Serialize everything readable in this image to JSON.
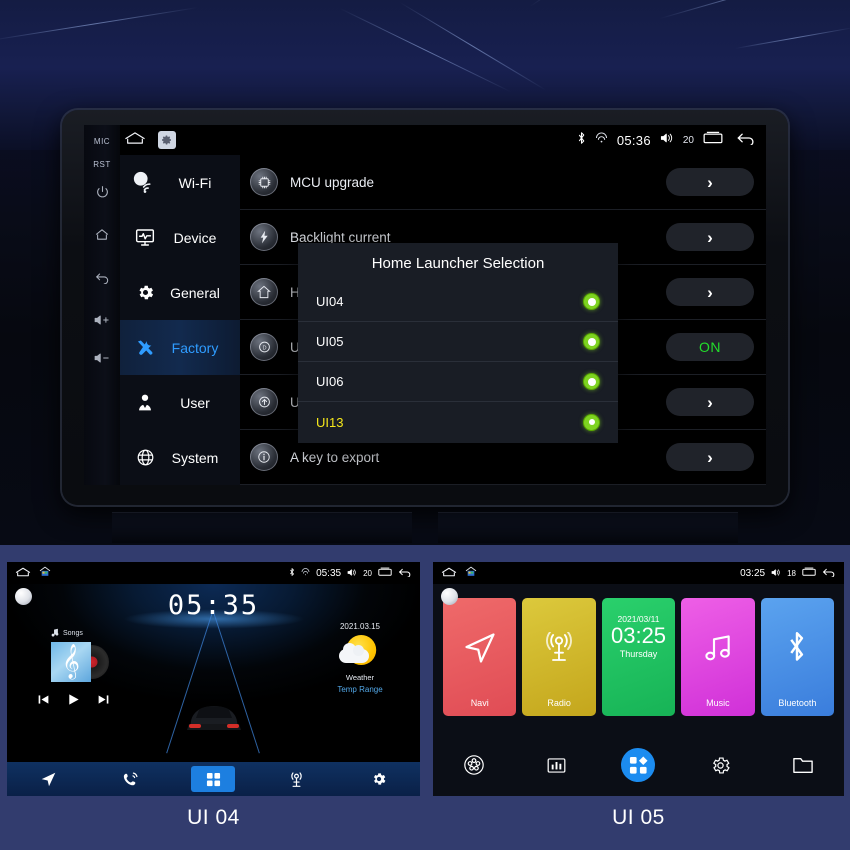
{
  "main_unit": {
    "hard_keys": [
      {
        "name": "MIC",
        "type": "text"
      },
      {
        "name": "RST",
        "type": "text"
      },
      {
        "name": "power",
        "type": "icon"
      },
      {
        "name": "home",
        "type": "icon"
      },
      {
        "name": "back",
        "type": "icon"
      },
      {
        "name": "volume-up",
        "type": "icon"
      },
      {
        "name": "volume-down",
        "type": "icon"
      }
    ],
    "status_bar": {
      "home_icon": "home-icon",
      "settings_icon": "gear-icon",
      "bluetooth_icon": "bluetooth-icon",
      "wifi_icon": "wifi-icon",
      "time": "05:36",
      "volume_icon": "volume-icon",
      "volume_level": "20",
      "recents_icon": "recents-icon",
      "back_icon": "back-icon"
    },
    "nav_items": [
      {
        "label": "Wi-Fi",
        "icon": "wifi-icon",
        "active": false
      },
      {
        "label": "Device",
        "icon": "device-icon",
        "active": false
      },
      {
        "label": "General",
        "icon": "gear-icon",
        "active": false
      },
      {
        "label": "Factory",
        "icon": "tools-icon",
        "active": true
      },
      {
        "label": "User",
        "icon": "user-icon",
        "active": false
      },
      {
        "label": "System",
        "icon": "globe-icon",
        "active": false
      }
    ],
    "settings_rows": [
      {
        "icon": "mcu-chip-icon",
        "label": "MCU upgrade",
        "action": "›",
        "action_type": "chevron"
      },
      {
        "icon": "backlight-icon",
        "label": "Backlight current",
        "action": "›",
        "action_type": "chevron"
      },
      {
        "icon": "launcher-icon",
        "label": "Home Launcher Selection  Current selection:UI13",
        "action": "›",
        "action_type": "chevron"
      },
      {
        "icon": "usb-error-icon",
        "label": "USB Error detection",
        "action": "ON",
        "action_type": "toggle"
      },
      {
        "icon": "usb-protocol-icon",
        "label": "USB protocol selection  Current Protocol 2.0",
        "action": "›",
        "action_type": "chevron"
      },
      {
        "icon": "info-icon",
        "label": "A key to export",
        "action": "›",
        "action_type": "chevron"
      }
    ],
    "dialog": {
      "title": "Home Launcher Selection",
      "options": [
        {
          "label": "UI04",
          "selected": false
        },
        {
          "label": "UI05",
          "selected": false
        },
        {
          "label": "UI06",
          "selected": false
        },
        {
          "label": "UI13",
          "selected": true
        }
      ]
    }
  },
  "preview_left": {
    "caption": "UI 04",
    "status_bar": {
      "home_icon": "home-icon",
      "apps_icon": "apps-house-icon",
      "bluetooth_icon": "bluetooth-icon",
      "wifi_icon": "wifi-icon",
      "time": "05:35",
      "volume_level": "20",
      "recents_icon": "recents-icon",
      "back_icon": "back-icon"
    },
    "clock": "05:35",
    "music": {
      "source_label": "Songs",
      "note_icon": "music-note-icon",
      "prev_icon": "previous-track-icon",
      "play_icon": "play-icon",
      "next_icon": "next-track-icon"
    },
    "weather": {
      "date": "2021.03.15",
      "icon": "sun-cloud-icon",
      "label": "Weather",
      "temp_range": "Temp Range"
    },
    "dock": [
      {
        "icon": "navigation-arrow-icon",
        "active": false
      },
      {
        "icon": "phone-icon",
        "active": false
      },
      {
        "icon": "apps-grid-icon",
        "active": true
      },
      {
        "icon": "radio-tower-icon",
        "active": false
      },
      {
        "icon": "gear-icon",
        "active": false
      }
    ]
  },
  "preview_right": {
    "caption": "UI 05",
    "status_bar": {
      "home_icon": "home-icon",
      "apps_icon": "apps-house-icon",
      "time": "03:25",
      "volume_level": "18",
      "recents_icon": "recents-icon",
      "back_icon": "back-icon"
    },
    "tiles": [
      {
        "label": "Navi",
        "icon": "navigation-arrow-icon",
        "color": "#e8585f"
      },
      {
        "label": "Radio",
        "icon": "radio-tower-icon",
        "color": "#cdb62f"
      },
      {
        "label": "",
        "icon": "clock-tile",
        "color": "#1fc063",
        "date": "2021/03/11",
        "time": "03:25",
        "day": "Thursday"
      },
      {
        "label": "Music",
        "icon": "music-note-icon",
        "color": "#e040e0"
      },
      {
        "label": "Bluetooth",
        "icon": "bluetooth-icon",
        "color": "#4a92e8"
      }
    ],
    "dock": [
      {
        "icon": "film-reel-icon",
        "active": false
      },
      {
        "icon": "equalizer-icon",
        "active": false
      },
      {
        "icon": "apps-grid-icon",
        "active": true
      },
      {
        "icon": "gear-icon",
        "active": false
      },
      {
        "icon": "folder-icon",
        "active": false
      }
    ]
  },
  "colors": {
    "accent_blue": "#2f9cff",
    "selected_yellow": "#f5e71a",
    "radio_green": "#7ed321",
    "on_green": "#23dd2b",
    "lower_bg": "#323c6e"
  }
}
